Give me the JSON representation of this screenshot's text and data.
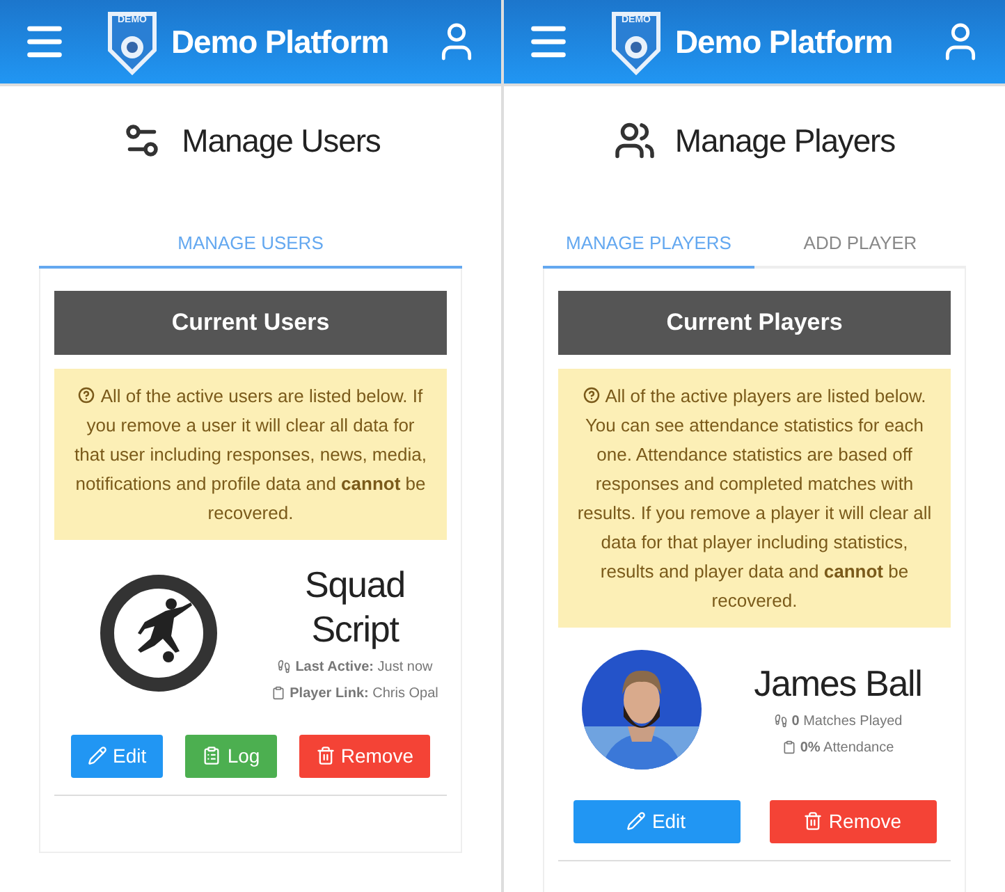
{
  "screens": [
    {
      "header": {
        "logo_text": "DEMO",
        "title": "Demo Platform"
      },
      "page_title": "Manage Users",
      "tabs": [
        {
          "label": "MANAGE USERS",
          "selected": true
        }
      ],
      "card_title": "Current Users",
      "notice": "All of the active users are listed below. If you remove a user it will clear all data for that user including responses, news, media, notifications and profile data and **cannot** be recovered.",
      "entry": {
        "name": "Squad Script",
        "avatar": {
          "kind": "logo"
        },
        "stats": [
          "**Last Active:** Just now",
          "**Player Link:** Chris Opal"
        ],
        "buttons": [
          {
            "label": "Edit",
            "kind": "edit"
          },
          {
            "label": "Log",
            "kind": "log"
          },
          {
            "label": "Remove",
            "kind": "remove"
          }
        ]
      }
    },
    {
      "header": {
        "logo_text": "DEMO",
        "title": "Demo Platform"
      },
      "page_title": "Manage Players",
      "tabs": [
        {
          "label": "MANAGE PLAYERS",
          "selected": true
        },
        {
          "label": "ADD PLAYER",
          "selected": false
        }
      ],
      "card_title": "Current Players",
      "notice": "All of the active players are listed below. You can see attendance statistics for each one. Attendance statistics are based off responses and completed matches with results. If you remove a player it will clear all data for that player including statistics, results and player data and **cannot** be recovered.",
      "entry": {
        "name": "James Ball",
        "avatar": {
          "kind": "picture"
        },
        "stats": [
          "**0** Matches Played",
          "**0%** Attendance"
        ],
        "buttons": [
          {
            "label": "Edit",
            "kind": "edit"
          },
          {
            "label": "Remove",
            "kind": "remove"
          }
        ]
      }
    }
  ]
}
